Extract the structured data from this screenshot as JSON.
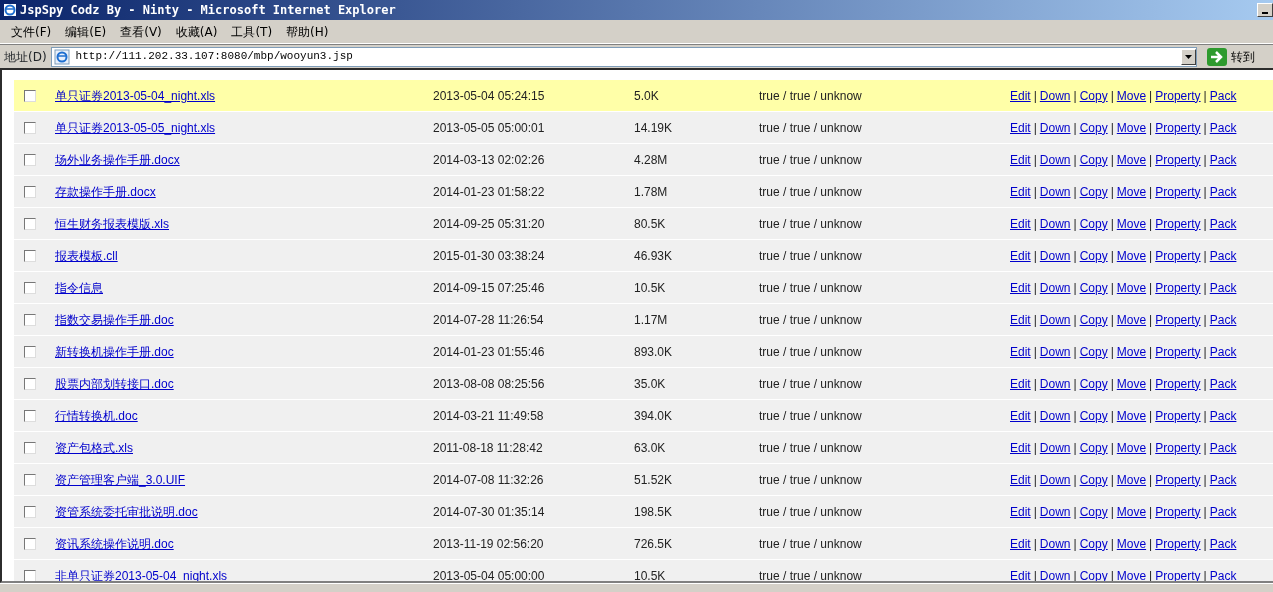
{
  "window": {
    "title": "JspSpy Codz By - Ninty - Microsoft Internet Explorer"
  },
  "menu": [
    "文件(F)",
    "编辑(E)",
    "查看(V)",
    "收藏(A)",
    "工具(T)",
    "帮助(H)"
  ],
  "address_bar": {
    "label": "地址(D)",
    "value": "http://111.202.33.107:8080/mbp/wooyun3.jsp",
    "go": "转到"
  },
  "files": [
    {
      "name": "单只证券2013-05-04_night.xls",
      "modified": "2013-05-04 05:24:15",
      "size": "5.0K",
      "perms": "true / true / unknow",
      "checked": false,
      "highlighted": true,
      "actions": [
        "Edit",
        "|",
        "Down",
        "|",
        "Copy",
        "|",
        "Move",
        "|",
        "Property",
        "|",
        "Pack"
      ]
    },
    {
      "name": "单只证券2013-05-05_night.xls",
      "modified": "2013-05-05 05:00:01",
      "size": "14.19K",
      "perms": "true / true / unknow",
      "checked": false,
      "highlighted": false,
      "actions": [
        "Edit",
        "|",
        "Down",
        "|",
        "Copy",
        "|",
        "Move",
        "|",
        "Property",
        "|",
        "Pack"
      ]
    },
    {
      "name": "场外业务操作手册.docx",
      "modified": "2014-03-13 02:02:26",
      "size": "4.28M",
      "perms": "true / true / unknow",
      "checked": false,
      "highlighted": false,
      "actions": [
        "Edit",
        "|",
        "Down",
        "|",
        "Copy",
        "|",
        "Move",
        "|",
        "Property",
        "|",
        "Pack"
      ]
    },
    {
      "name": "存款操作手册.docx",
      "modified": "2014-01-23 01:58:22",
      "size": "1.78M",
      "perms": "true / true / unknow",
      "checked": false,
      "highlighted": false,
      "actions": [
        "Edit",
        "|",
        "Down",
        "|",
        "Copy",
        "|",
        "Move",
        "|",
        "Property",
        "|",
        "Pack"
      ]
    },
    {
      "name": "恒生财务报表模版.xls",
      "modified": "2014-09-25 05:31:20",
      "size": "80.5K",
      "perms": "true / true / unknow",
      "checked": false,
      "highlighted": false,
      "actions": [
        "Edit",
        "|",
        "Down",
        "|",
        "Copy",
        "|",
        "Move",
        "|",
        "Property",
        "|",
        "Pack"
      ]
    },
    {
      "name": "报表模板.cll",
      "modified": "2015-01-30 03:38:24",
      "size": "46.93K",
      "perms": "true / true / unknow",
      "checked": false,
      "highlighted": false,
      "actions": [
        "Edit",
        "|",
        "Down",
        "|",
        "Copy",
        "|",
        "Move",
        "|",
        "Property",
        "|",
        "Pack"
      ]
    },
    {
      "name": "指令信息",
      "modified": "2014-09-15 07:25:46",
      "size": "10.5K",
      "perms": "true / true / unknow",
      "checked": false,
      "highlighted": false,
      "actions": [
        "Edit",
        "|",
        "Down",
        "|",
        "Copy",
        "|",
        "Move",
        "|",
        "Property",
        "|",
        "Pack"
      ]
    },
    {
      "name": "指数交易操作手册.doc",
      "modified": "2014-07-28 11:26:54",
      "size": "1.17M",
      "perms": "true / true / unknow",
      "checked": false,
      "highlighted": false,
      "actions": [
        "Edit",
        "|",
        "Down",
        "|",
        "Copy",
        "|",
        "Move",
        "|",
        "Property",
        "|",
        "Pack"
      ]
    },
    {
      "name": "新转换机操作手册.doc",
      "modified": "2014-01-23 01:55:46",
      "size": "893.0K",
      "perms": "true / true / unknow",
      "checked": false,
      "highlighted": false,
      "actions": [
        "Edit",
        "|",
        "Down",
        "|",
        "Copy",
        "|",
        "Move",
        "|",
        "Property",
        "|",
        "Pack"
      ]
    },
    {
      "name": "股票内部划转接口.doc",
      "modified": "2013-08-08 08:25:56",
      "size": "35.0K",
      "perms": "true / true / unknow",
      "checked": false,
      "highlighted": false,
      "actions": [
        "Edit",
        "|",
        "Down",
        "|",
        "Copy",
        "|",
        "Move",
        "|",
        "Property",
        "|",
        "Pack"
      ]
    },
    {
      "name": "行情转换机.doc",
      "modified": "2014-03-21 11:49:58",
      "size": "394.0K",
      "perms": "true / true / unknow",
      "checked": false,
      "highlighted": false,
      "actions": [
        "Edit",
        "|",
        "Down",
        "|",
        "Copy",
        "|",
        "Move",
        "|",
        "Property",
        "|",
        "Pack"
      ]
    },
    {
      "name": "资产包格式.xls",
      "modified": "2011-08-18 11:28:42",
      "size": "63.0K",
      "perms": "true / true / unknow",
      "checked": false,
      "highlighted": false,
      "actions": [
        "Edit",
        "|",
        "Down",
        "|",
        "Copy",
        "|",
        "Move",
        "|",
        "Property",
        "|",
        "Pack"
      ]
    },
    {
      "name": "资产管理客户端_3.0.UIF",
      "modified": "2014-07-08 11:32:26",
      "size": "51.52K",
      "perms": "true / true / unknow",
      "checked": false,
      "highlighted": false,
      "actions": [
        "Edit",
        "|",
        "Down",
        "|",
        "Copy",
        "|",
        "Move",
        "|",
        "Property",
        "|",
        "Pack"
      ]
    },
    {
      "name": "资管系统委托审批说明.doc",
      "modified": "2014-07-30 01:35:14",
      "size": "198.5K",
      "perms": "true / true / unknow",
      "checked": false,
      "highlighted": false,
      "actions": [
        "Edit",
        "|",
        "Down",
        "|",
        "Copy",
        "|",
        "Move",
        "|",
        "Property",
        "|",
        "Pack"
      ]
    },
    {
      "name": "资讯系统操作说明.doc",
      "modified": "2013-11-19 02:56:20",
      "size": "726.5K",
      "perms": "true / true / unknow",
      "checked": false,
      "highlighted": false,
      "actions": [
        "Edit",
        "|",
        "Down",
        "|",
        "Copy",
        "|",
        "Move",
        "|",
        "Property",
        "|",
        "Pack"
      ]
    },
    {
      "name": "非单只证券2013-05-04_night.xls",
      "modified": "2013-05-04 05:00:00",
      "size": "10.5K",
      "perms": "true / true / unknow",
      "checked": false,
      "highlighted": false,
      "actions": [
        "Edit",
        "|",
        "Down",
        "|",
        "Copy",
        "|",
        "Move",
        "|",
        "Property",
        "|",
        "Pack"
      ]
    }
  ]
}
